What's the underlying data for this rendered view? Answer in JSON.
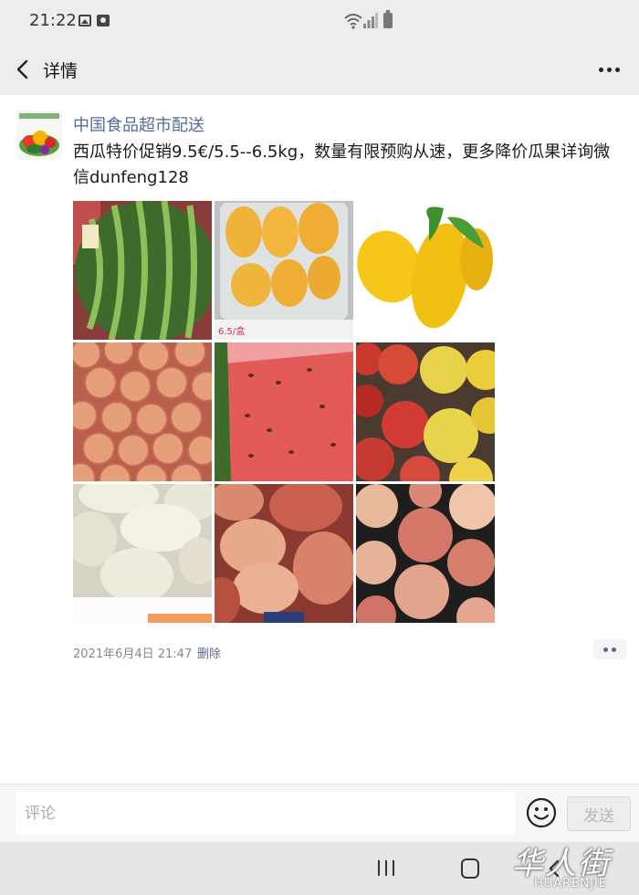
{
  "status_bar": {
    "time": "21:22"
  },
  "nav": {
    "title": "详情"
  },
  "post": {
    "author": "中国食品超市配送",
    "text": "西瓜特价促销9.5€/5.5--6.5kg，数量有限预购从速，更多降价瓜果详询微信dunfeng128",
    "timestamp": "2021年6月4日 21:47",
    "delete_label": "删除",
    "images": [
      {
        "subject": "watermelon"
      },
      {
        "subject": "mangoes-in-box",
        "price_tag": "6.5/盒"
      },
      {
        "subject": "yellow-mangoes"
      },
      {
        "subject": "lychees"
      },
      {
        "subject": "watermelon-flesh"
      },
      {
        "subject": "apples"
      },
      {
        "subject": "white-melons"
      },
      {
        "subject": "flat-peaches"
      },
      {
        "subject": "peaches"
      }
    ]
  },
  "comment_bar": {
    "placeholder": "评论",
    "send_label": "发送"
  },
  "watermark": {
    "logo": "华人街",
    "text": "HUARENJIE"
  },
  "colors": {
    "link": "#576b95",
    "bar_background": "#ededed"
  }
}
